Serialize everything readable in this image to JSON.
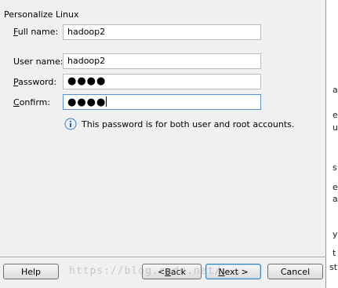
{
  "section_title": "Personalize Linux",
  "fields": {
    "full_name": {
      "label_key": "F",
      "label_rest": "ull name:",
      "value": "hadoop2"
    },
    "user_name": {
      "label": "User name:",
      "value": "hadoop2"
    },
    "password": {
      "label_key": "P",
      "label_rest": "assword:",
      "value": "●●●●"
    },
    "confirm": {
      "label_key": "C",
      "label_rest": "onfirm:",
      "value": "●●●●"
    }
  },
  "info_text": "This password is for both user and root accounts.",
  "buttons": {
    "help": "Help",
    "back_prefix": "< ",
    "back_key": "B",
    "back_rest": "ack",
    "next_key": "N",
    "next_rest": "ext >",
    "cancel": "Cancel"
  },
  "watermark": "https://blog.csdn.net/...",
  "right_strip_fragments": [
    "a",
    "e",
    "u",
    "s",
    "e",
    "a",
    "y",
    "t",
    "st"
  ]
}
